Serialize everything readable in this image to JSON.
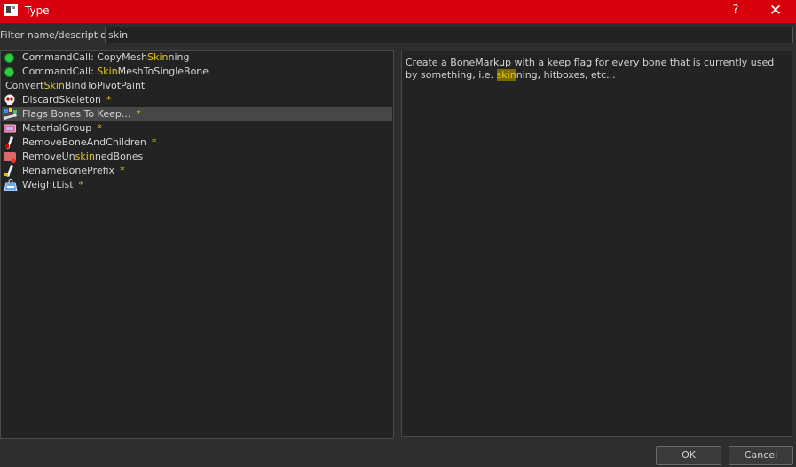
{
  "window": {
    "title": "Type",
    "help_label": "?",
    "close_label": "✕"
  },
  "filter": {
    "label": "Filter name/description:",
    "value": "skin"
  },
  "items": [
    {
      "pre": "CommandCall: CopyMesh",
      "hl": "Skin",
      "post": "ning",
      "star": "",
      "icon": "green-circle-icon"
    },
    {
      "pre": "CommandCall: ",
      "hl": "Skin",
      "post": "MeshToSingleBone",
      "star": "",
      "icon": "green-circle-icon"
    },
    {
      "pre": "Convert",
      "hl": "Skin",
      "post": "BindToPivotPaint",
      "star": "",
      "icon": ""
    },
    {
      "pre": "DiscardSkeleton",
      "hl": "",
      "post": "",
      "star": "*",
      "icon": "skull-icon"
    },
    {
      "pre": "Flags Bones To Keep...",
      "hl": "",
      "post": "",
      "star": "*",
      "icon": "bone-flags-icon"
    },
    {
      "pre": "MaterialGroup",
      "hl": "",
      "post": "",
      "star": "*",
      "icon": "material-icon"
    },
    {
      "pre": "RemoveBoneAndChildren",
      "hl": "",
      "post": "",
      "star": "*",
      "icon": "bone-remove-icon"
    },
    {
      "pre": "RemoveUn",
      "hl": "skin",
      "post": "nedBones",
      "star": "",
      "icon": "remove-unskinned-icon"
    },
    {
      "pre": "RenameBonePrefix",
      "hl": "",
      "post": "",
      "star": "*",
      "icon": "bone-rename-icon"
    },
    {
      "pre": "WeightList",
      "hl": "",
      "post": "",
      "star": "*",
      "icon": "weight-icon"
    }
  ],
  "selected_index": 4,
  "description": {
    "pre": "Create a BoneMarkup with a keep flag for every bone that is currently used by something, i.e. ",
    "hl": "skin",
    "post": "ning, hitboxes, etc..."
  },
  "buttons": {
    "ok": "OK",
    "cancel": "Cancel"
  }
}
